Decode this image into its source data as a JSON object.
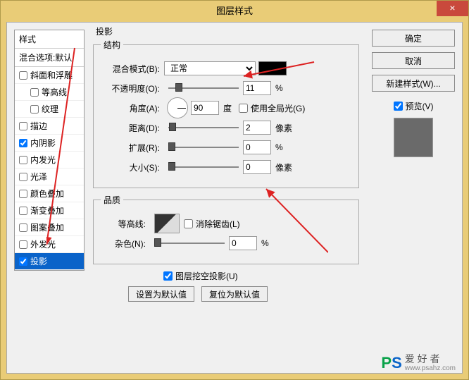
{
  "title": "图层样式",
  "close_glyph": "×",
  "styles_panel": {
    "header": "样式",
    "blending_default": "混合选项:默认",
    "items": [
      {
        "label": "斜面和浮雕",
        "checked": false,
        "selected": false
      },
      {
        "label": "等高线",
        "checked": false,
        "selected": false,
        "sub": true
      },
      {
        "label": "纹理",
        "checked": false,
        "selected": false,
        "sub": true
      },
      {
        "label": "描边",
        "checked": false,
        "selected": false
      },
      {
        "label": "内阴影",
        "checked": true,
        "selected": false
      },
      {
        "label": "内发光",
        "checked": false,
        "selected": false
      },
      {
        "label": "光泽",
        "checked": false,
        "selected": false
      },
      {
        "label": "颜色叠加",
        "checked": false,
        "selected": false
      },
      {
        "label": "渐变叠加",
        "checked": false,
        "selected": false
      },
      {
        "label": "图案叠加",
        "checked": false,
        "selected": false
      },
      {
        "label": "外发光",
        "checked": false,
        "selected": false
      },
      {
        "label": "投影",
        "checked": true,
        "selected": true
      }
    ]
  },
  "main": {
    "group_title": "投影",
    "structure": {
      "legend": "结构",
      "blend_mode_label": "混合模式(B):",
      "blend_mode_value": "正常",
      "color": "#000000",
      "opacity_label": "不透明度(O):",
      "opacity_value": "11",
      "opacity_unit": "%",
      "angle_label": "角度(A):",
      "angle_value": "90",
      "angle_unit": "度",
      "global_light_label": "使用全局光(G)",
      "global_light_checked": false,
      "distance_label": "距离(D):",
      "distance_value": "2",
      "distance_unit": "像素",
      "spread_label": "扩展(R):",
      "spread_value": "0",
      "spread_unit": "%",
      "size_label": "大小(S):",
      "size_value": "0",
      "size_unit": "像素"
    },
    "quality": {
      "legend": "品质",
      "contour_label": "等高线:",
      "antialias_label": "消除锯齿(L)",
      "antialias_checked": false,
      "noise_label": "杂色(N):",
      "noise_value": "0",
      "noise_unit": "%"
    },
    "knockout_label": "图层挖空投影(U)",
    "knockout_checked": true,
    "set_default": "设置为默认值",
    "reset_default": "复位为默认值"
  },
  "right": {
    "ok": "确定",
    "cancel": "取消",
    "new_style": "新建样式(W)...",
    "preview_label": "预览(V)",
    "preview_checked": true
  },
  "watermark": {
    "p": "P",
    "s": "S",
    "text": "爱 好 者",
    "url": "www.psahz.com"
  }
}
